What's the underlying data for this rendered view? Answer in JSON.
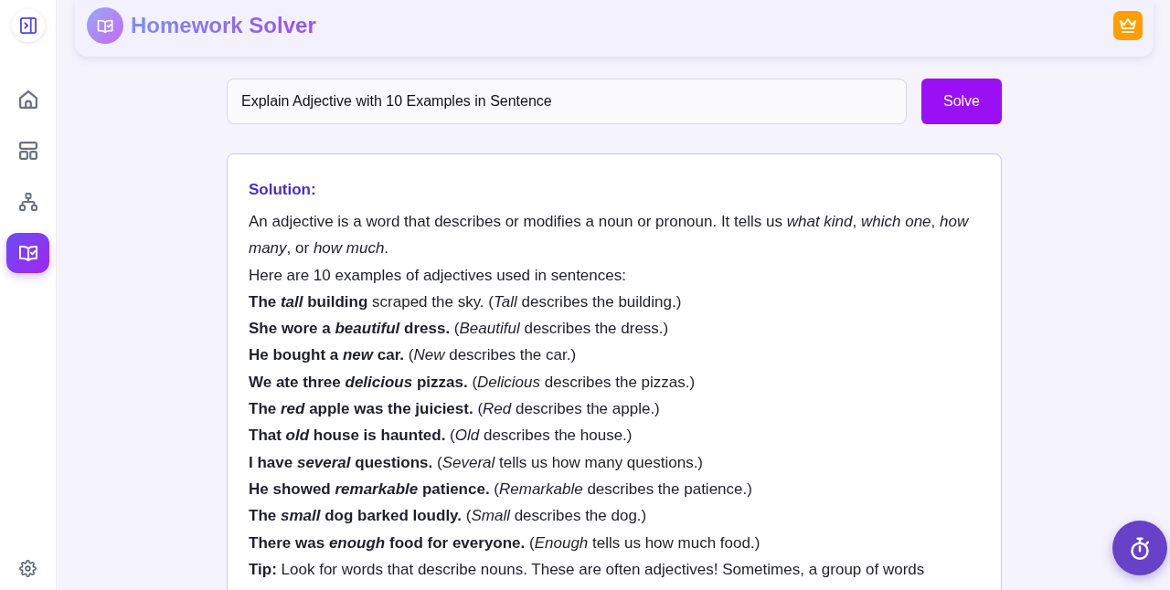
{
  "sidebar": {
    "items": [
      {
        "kind": "home",
        "selected": false
      },
      {
        "kind": "templates",
        "selected": false
      },
      {
        "kind": "structure",
        "selected": false
      },
      {
        "kind": "solver",
        "selected": true
      }
    ]
  },
  "header": {
    "title": "Homework Solver"
  },
  "question": {
    "value": "Explain Adjective with 10 Examples in Sentence",
    "button": "Solve"
  },
  "solution": {
    "heading": "Solution:",
    "paragraphs": [
      "An adjective is a word that describes or modifies a noun or pronoun. It tells us *what kind*, *which one*, *how many*, or *how much*.",
      "Here are 10 examples of adjectives used in sentences:",
      "**The *tall* building** scraped the sky. (*Tall* describes the building.)",
      "**She wore a *beautiful* dress.** (*Beautiful* describes the dress.)",
      "**He bought a *new* car.** (*New* describes the car.)",
      "**We ate three *delicious* pizzas.** (*Delicious* describes the pizzas.)",
      "**The *red* apple was the juiciest.** (*Red* describes the apple.)",
      "**That *old* house is haunted.** (*Old* describes the house.)",
      "**I have *several* questions.** (*Several* tells us how many questions.)",
      "**He showed *remarkable* patience.** (*Remarkable* describes the patience.)",
      "**The *small* dog barked loudly.** (*Small* describes the dog.)",
      "**There was *enough* food for everyone.** (*Enough* tells us how much food.)",
      "**Tip:** Look for words that describe nouns. These are often adjectives! Sometimes, a group of words"
    ]
  }
}
